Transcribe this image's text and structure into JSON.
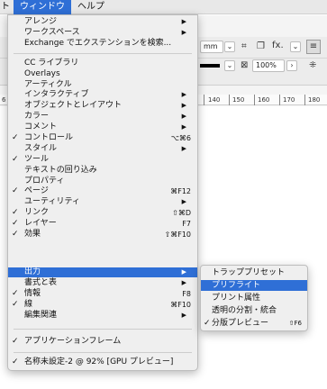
{
  "menubar": {
    "items": [
      {
        "label": "ト"
      },
      {
        "label": "ウィンドウ"
      },
      {
        "label": "ヘルプ"
      }
    ]
  },
  "background": {
    "unit_field": "mm",
    "zoom_field": "100%",
    "fx_label": "fx.",
    "ruler_ticks": [
      "140",
      "150",
      "160",
      "170",
      "180"
    ],
    "ruler_left_tick": "6"
  },
  "menu": {
    "items": [
      {
        "label": "アレンジ",
        "submenu": true
      },
      {
        "label": "ワークスペース",
        "submenu": true
      },
      {
        "label": "Exchange でエクステンションを検索..."
      },
      {
        "label": "CC ライブラリ"
      },
      {
        "label": "Overlays"
      },
      {
        "label": "アーティクル"
      },
      {
        "label": "インタラクティブ",
        "submenu": true
      },
      {
        "label": "オブジェクトとレイアウト",
        "submenu": true
      },
      {
        "label": "カラー",
        "submenu": true
      },
      {
        "label": "コメント",
        "submenu": true
      },
      {
        "label": "コントロール",
        "checked": true,
        "shortcut": "⌥⌘6"
      },
      {
        "label": "スタイル",
        "submenu": true
      },
      {
        "label": "ツール",
        "checked": true
      },
      {
        "label": "テキストの回り込み"
      },
      {
        "label": "プロパティ"
      },
      {
        "label": "ページ",
        "checked": true,
        "shortcut": "⌘F12"
      },
      {
        "label": "ユーティリティ",
        "submenu": true
      },
      {
        "label": "リンク",
        "checked": true,
        "shortcut": "⇧⌘D"
      },
      {
        "label": "レイヤー",
        "checked": true,
        "shortcut": "F7"
      },
      {
        "label": "効果",
        "checked": true,
        "shortcut": "⇧⌘F10"
      },
      {
        "label": "出力",
        "submenu": true,
        "highlighted": true
      },
      {
        "label": "書式と表",
        "submenu": true
      },
      {
        "label": "情報",
        "checked": true,
        "shortcut": "F8"
      },
      {
        "label": "線",
        "checked": true,
        "shortcut": "⌘F10"
      },
      {
        "label": "編集関連",
        "submenu": true
      },
      {
        "label": "アプリケーションフレーム",
        "checked": true
      },
      {
        "label": "名称未設定-2 @ 92% [GPU プレビュー]",
        "checked": true
      }
    ],
    "check_glyph": "✓",
    "arrow_glyph": "▶"
  },
  "submenu": {
    "items": [
      {
        "label": "トラッププリセット"
      },
      {
        "label": "プリフライト",
        "highlighted": true
      },
      {
        "label": "プリント属性"
      },
      {
        "label": "透明の分割・統合"
      },
      {
        "label": "分版プレビュー",
        "checked": true,
        "shortcut": "⇧F6"
      }
    ]
  },
  "colors": {
    "highlight": "#2f6fd6",
    "menu_bg": "#efefef"
  }
}
